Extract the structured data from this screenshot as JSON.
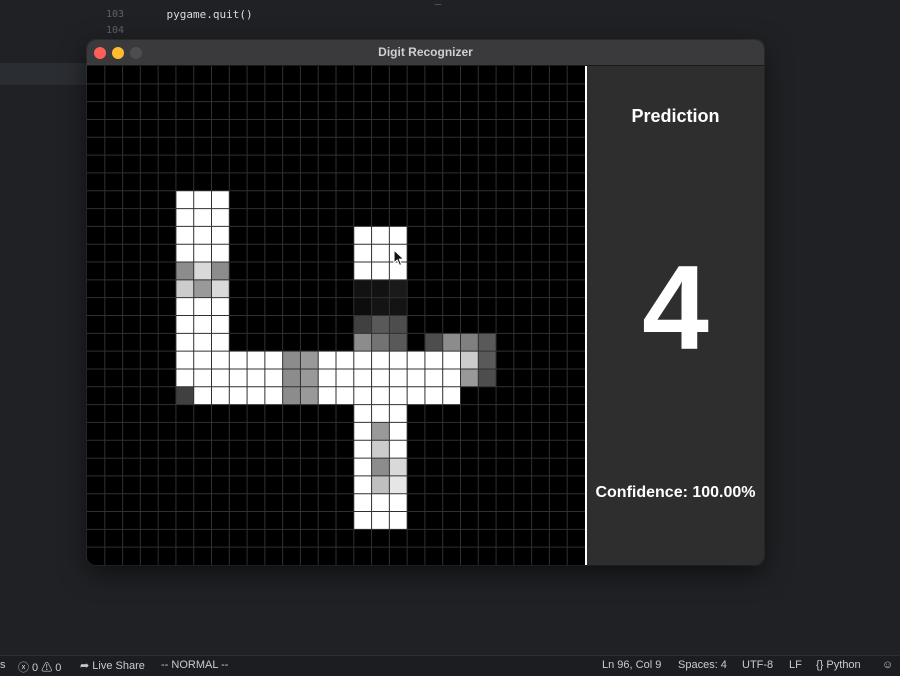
{
  "editor": {
    "lines": [
      {
        "num": "103",
        "code": "    pygame.quit()"
      },
      {
        "num": "104",
        "code": ""
      }
    ],
    "partial_top": "                                              _"
  },
  "window": {
    "title": "Digit Recognizer"
  },
  "canvas": {
    "cols": 28,
    "rows": 28,
    "grid_line_color": "#303030",
    "pixels": [
      [
        5,
        7,
        1
      ],
      [
        6,
        7,
        1
      ],
      [
        7,
        7,
        1
      ],
      [
        5,
        8,
        1
      ],
      [
        6,
        8,
        1
      ],
      [
        7,
        8,
        1
      ],
      [
        5,
        9,
        1
      ],
      [
        6,
        9,
        1
      ],
      [
        7,
        9,
        1
      ],
      [
        5,
        10,
        1
      ],
      [
        6,
        10,
        1
      ],
      [
        7,
        10,
        1
      ],
      [
        5,
        11,
        0.55
      ],
      [
        6,
        11,
        0.85
      ],
      [
        7,
        11,
        0.55
      ],
      [
        5,
        12,
        0.8
      ],
      [
        6,
        12,
        0.6
      ],
      [
        7,
        12,
        0.85
      ],
      [
        5,
        13,
        1
      ],
      [
        6,
        13,
        1
      ],
      [
        7,
        13,
        1
      ],
      [
        5,
        14,
        1
      ],
      [
        6,
        14,
        1
      ],
      [
        7,
        14,
        1
      ],
      [
        5,
        15,
        1
      ],
      [
        6,
        15,
        1
      ],
      [
        7,
        15,
        1
      ],
      [
        5,
        16,
        1
      ],
      [
        6,
        16,
        1
      ],
      [
        7,
        16,
        1
      ],
      [
        8,
        16,
        1
      ],
      [
        9,
        16,
        1
      ],
      [
        10,
        16,
        1
      ],
      [
        11,
        16,
        0.55
      ],
      [
        12,
        16,
        0.6
      ],
      [
        13,
        16,
        1
      ],
      [
        14,
        16,
        1
      ],
      [
        15,
        16,
        1
      ],
      [
        16,
        16,
        1
      ],
      [
        17,
        16,
        1
      ],
      [
        18,
        16,
        1
      ],
      [
        19,
        16,
        1
      ],
      [
        20,
        16,
        1
      ],
      [
        21,
        16,
        0.8
      ],
      [
        22,
        16,
        0.35
      ],
      [
        5,
        17,
        1
      ],
      [
        6,
        17,
        1
      ],
      [
        7,
        17,
        1
      ],
      [
        8,
        17,
        1
      ],
      [
        9,
        17,
        1
      ],
      [
        10,
        17,
        1
      ],
      [
        11,
        17,
        0.55
      ],
      [
        12,
        17,
        0.6
      ],
      [
        13,
        17,
        1
      ],
      [
        14,
        17,
        1
      ],
      [
        15,
        17,
        1
      ],
      [
        16,
        17,
        1
      ],
      [
        17,
        17,
        1
      ],
      [
        18,
        17,
        1
      ],
      [
        19,
        17,
        1
      ],
      [
        20,
        17,
        1
      ],
      [
        21,
        17,
        0.6
      ],
      [
        22,
        17,
        0.3
      ],
      [
        5,
        18,
        0.25
      ],
      [
        6,
        18,
        1
      ],
      [
        7,
        18,
        1
      ],
      [
        8,
        18,
        1
      ],
      [
        9,
        18,
        1
      ],
      [
        10,
        18,
        1
      ],
      [
        11,
        18,
        0.55
      ],
      [
        12,
        18,
        0.6
      ],
      [
        13,
        18,
        1
      ],
      [
        14,
        18,
        1
      ],
      [
        15,
        18,
        1
      ],
      [
        16,
        18,
        1
      ],
      [
        17,
        18,
        1
      ],
      [
        18,
        18,
        1
      ],
      [
        19,
        18,
        1
      ],
      [
        20,
        18,
        1
      ],
      [
        15,
        9,
        1
      ],
      [
        16,
        9,
        1
      ],
      [
        17,
        9,
        1
      ],
      [
        15,
        10,
        1
      ],
      [
        16,
        10,
        1
      ],
      [
        17,
        10,
        1
      ],
      [
        15,
        11,
        1
      ],
      [
        16,
        11,
        1
      ],
      [
        17,
        11,
        1
      ],
      [
        15,
        12,
        0.07
      ],
      [
        16,
        12,
        0.07
      ],
      [
        17,
        12,
        0.1
      ],
      [
        15,
        13,
        0.05
      ],
      [
        16,
        13,
        0.08
      ],
      [
        17,
        13,
        0.08
      ],
      [
        15,
        14,
        0.25
      ],
      [
        16,
        14,
        0.35
      ],
      [
        17,
        14,
        0.3
      ],
      [
        15,
        15,
        0.55
      ],
      [
        16,
        15,
        0.45
      ],
      [
        17,
        15,
        0.35
      ],
      [
        19,
        15,
        0.3
      ],
      [
        20,
        15,
        0.55
      ],
      [
        21,
        15,
        0.5
      ],
      [
        22,
        15,
        0.35
      ],
      [
        15,
        19,
        1
      ],
      [
        16,
        19,
        1
      ],
      [
        17,
        19,
        1
      ],
      [
        15,
        20,
        1
      ],
      [
        16,
        20,
        0.6
      ],
      [
        17,
        20,
        1
      ],
      [
        15,
        21,
        1
      ],
      [
        16,
        21,
        0.8
      ],
      [
        17,
        21,
        1
      ],
      [
        15,
        22,
        1
      ],
      [
        16,
        22,
        0.55
      ],
      [
        17,
        22,
        0.85
      ],
      [
        15,
        23,
        1
      ],
      [
        16,
        23,
        0.75
      ],
      [
        17,
        23,
        0.9
      ],
      [
        15,
        24,
        1
      ],
      [
        16,
        24,
        1
      ],
      [
        17,
        24,
        1
      ],
      [
        15,
        25,
        1
      ],
      [
        16,
        25,
        1
      ],
      [
        17,
        25,
        1
      ]
    ]
  },
  "panel": {
    "heading": "Prediction",
    "digit": "4",
    "confidence": "Confidence: 100.00%"
  },
  "statusbar": {
    "left_fragment": "s",
    "problems": "ⓧ 0 ⚠ 0",
    "live_share": "Live Share",
    "mode": "-- NORMAL --",
    "position": "Ln 96, Col 9",
    "spaces": "Spaces: 4",
    "encoding": "UTF-8",
    "eol": "LF",
    "language": "Python"
  },
  "colors": {
    "close": "#ff5f57",
    "minimize": "#febc2e",
    "zoom": "#4d4d4f",
    "panel_bg": "#2e2e2e"
  }
}
